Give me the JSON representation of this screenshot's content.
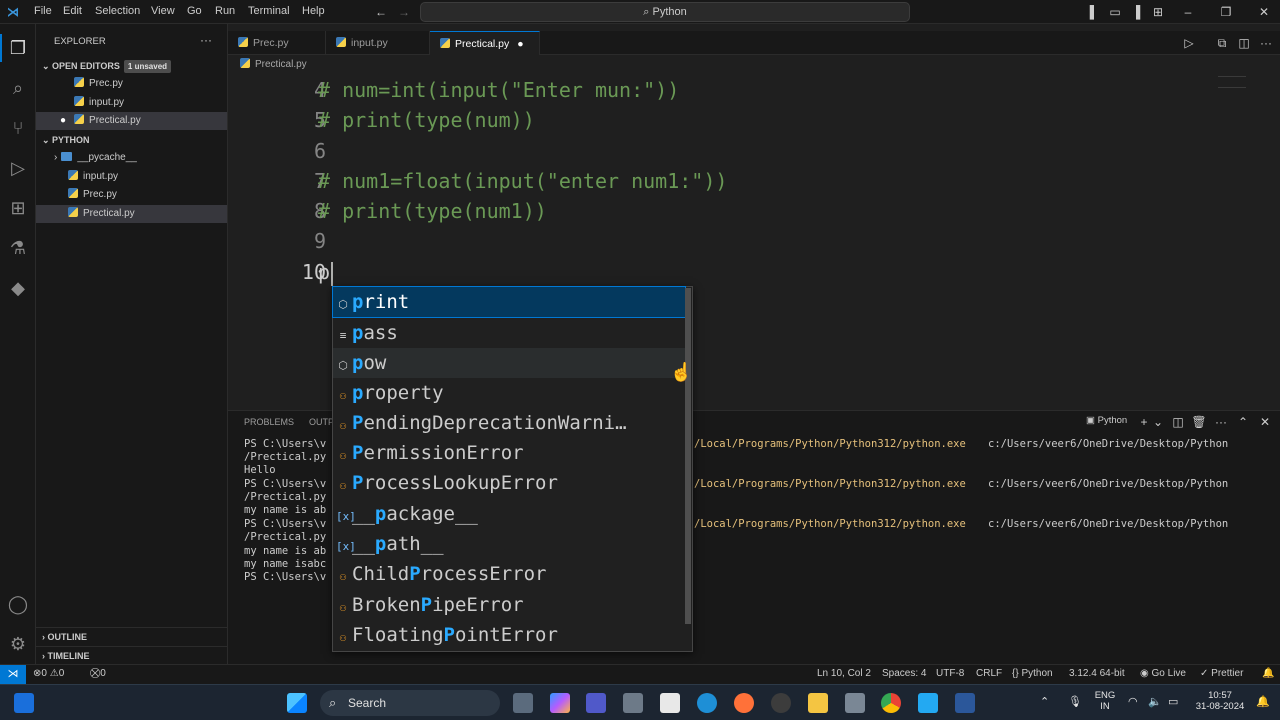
{
  "titlebar": {
    "menus": [
      "File",
      "Edit",
      "Selection",
      "View",
      "Go",
      "Run",
      "Terminal",
      "Help"
    ],
    "search": "Python"
  },
  "sidebar": {
    "title": "EXPLORER",
    "open_editors_label": "OPEN EDITORS",
    "unsaved_badge": "1 unsaved",
    "open_editors": [
      "Prec.py",
      "input.py",
      "Prectical.py"
    ],
    "folder_label": "PYTHON",
    "files": [
      "__pycache__",
      "input.py",
      "Prec.py",
      "Prectical.py"
    ],
    "outline_label": "OUTLINE",
    "timeline_label": "TIMELINE"
  },
  "tabs": [
    {
      "label": "Prec.py"
    },
    {
      "label": "input.py"
    },
    {
      "label": "Prectical.py"
    }
  ],
  "breadcrumb": "Prectical.py",
  "editor": {
    "lines": [
      {
        "num": "4",
        "text": "# num=int(input(\"Enter mun:\"))"
      },
      {
        "num": "5",
        "text": "# print(type(num))"
      },
      {
        "num": "6",
        "text": ""
      },
      {
        "num": "7",
        "text": "# num1=float(input(\"enter num1:\"))"
      },
      {
        "num": "8",
        "text": "# print(type(num1))"
      },
      {
        "num": "9",
        "text": ""
      },
      {
        "num": "10",
        "text": "p"
      }
    ]
  },
  "suggestions": [
    {
      "pre": "",
      "hl": "p",
      "post": "rint",
      "icon": "cube-icon"
    },
    {
      "pre": "",
      "hl": "p",
      "post": "ass",
      "icon": "keyword-icon"
    },
    {
      "pre": "",
      "hl": "p",
      "post": "ow",
      "icon": "cube-icon"
    },
    {
      "pre": "",
      "hl": "p",
      "post": "roperty",
      "icon": "class-icon"
    },
    {
      "pre": "",
      "hl": "P",
      "post": "endingDeprecationWarni…",
      "icon": "class-icon"
    },
    {
      "pre": "",
      "hl": "P",
      "post": "ermissionError",
      "icon": "class-icon"
    },
    {
      "pre": "",
      "hl": "P",
      "post": "rocessLookupError",
      "icon": "class-icon"
    },
    {
      "pre": "__",
      "hl": "p",
      "post": "ackage__",
      "icon": "variable-icon"
    },
    {
      "pre": "__",
      "hl": "p",
      "post": "ath__",
      "icon": "variable-icon"
    },
    {
      "pre": "Child",
      "hl": "P",
      "post": "rocessError",
      "icon": "class-icon"
    },
    {
      "pre": "Broken",
      "hl": "P",
      "post": "ipeError",
      "icon": "class-icon"
    },
    {
      "pre": "Floating",
      "hl": "P",
      "post": "ointError",
      "icon": "class-icon"
    }
  ],
  "panel": {
    "tabs": [
      "PROBLEMS",
      "OUTP"
    ],
    "shell": "Python",
    "terminal_left": [
      "PS C:\\Users\\v",
      "/Prectical.py",
      "Hello",
      "PS C:\\Users\\v",
      "/Prectical.py",
      "my name is ab",
      "PS C:\\Users\\v",
      "/Prectical.py",
      "my name is ab",
      "my name isabc",
      "PS C:\\Users\\v"
    ],
    "terminal_right_path": "/Local/Programs/Python/Python312/python.exe",
    "terminal_right_arg": "c:/Users/veer6/OneDrive/Desktop/Python"
  },
  "statusbar": {
    "errors": "0",
    "warnings": "0",
    "ports": "0",
    "position": "Ln 10, Col 2",
    "spaces": "Spaces: 4",
    "encoding": "UTF-8",
    "eol": "CRLF",
    "language": "Python",
    "interpreter": "3.12.4 64-bit",
    "golive": "Go Live",
    "prettier": "Prettier"
  },
  "taskbar": {
    "search": "Search",
    "lang1": "ENG",
    "lang2": "IN",
    "time": "10:57",
    "date": "31-08-2024"
  },
  "colors": {
    "accent": "#0078d4",
    "comment": "#6a9955",
    "match": "#2aaaff",
    "terminal_path": "#e5c07b"
  }
}
